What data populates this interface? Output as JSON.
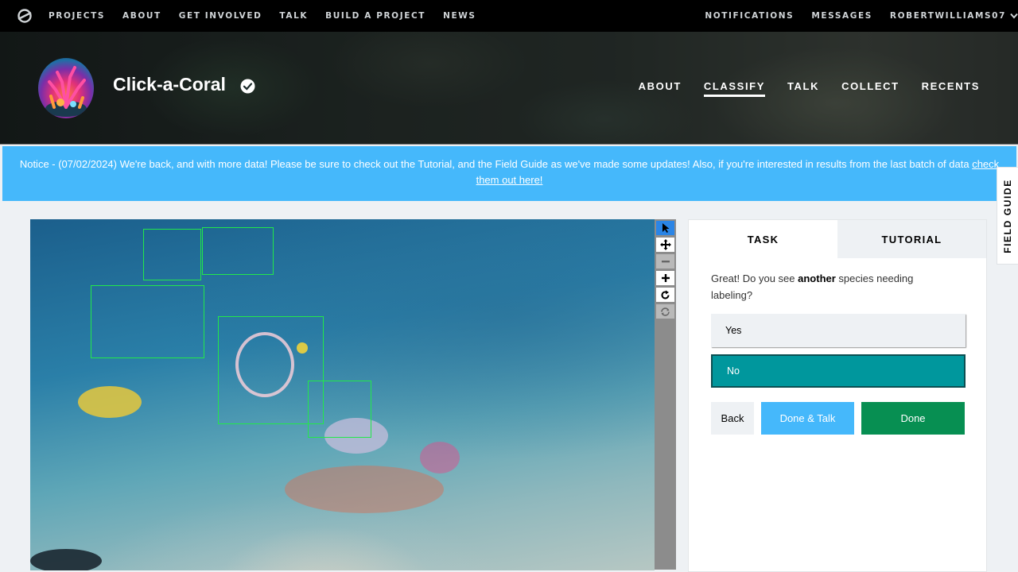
{
  "topnav": {
    "links": [
      "PROJECTS",
      "ABOUT",
      "GET INVOLVED",
      "TALK",
      "BUILD A PROJECT",
      "NEWS"
    ],
    "notifications": "NOTIFICATIONS",
    "messages": "MESSAGES",
    "username": "ROBERTWILLIAMS07"
  },
  "project": {
    "title": "Click-a-Coral",
    "nav": [
      "ABOUT",
      "CLASSIFY",
      "TALK",
      "COLLECT",
      "RECENTS"
    ],
    "active_nav": "CLASSIFY"
  },
  "notice": {
    "text": "Notice - (07/02/2024) We're back, and with more data! Please be sure to check out the Tutorial, and the Field Guide as we've made some updates! Also, if you're interested in results from the last batch of data ",
    "link": "check them out here!"
  },
  "field_guide": "FIELD GUIDE",
  "task": {
    "tabs": [
      "TASK",
      "TUTORIAL"
    ],
    "question_prefix": "Great! Do you see ",
    "question_bold": "another",
    "question_suffix": " species needing labeling?",
    "answers": [
      "Yes",
      "No"
    ],
    "selected_answer": "No",
    "back_label": "Back",
    "done_talk_label": "Done & Talk",
    "done_label": "Done"
  },
  "colors": {
    "notice_bg": "#45b8fb",
    "selected_answer": "#00979d",
    "done_button": "#078f52",
    "annotation_box": "#22e84a"
  },
  "toolbar_icons": [
    "pointer-icon",
    "move-icon",
    "zoom-out-icon",
    "zoom-in-icon",
    "rotate-icon",
    "reset-icon"
  ]
}
